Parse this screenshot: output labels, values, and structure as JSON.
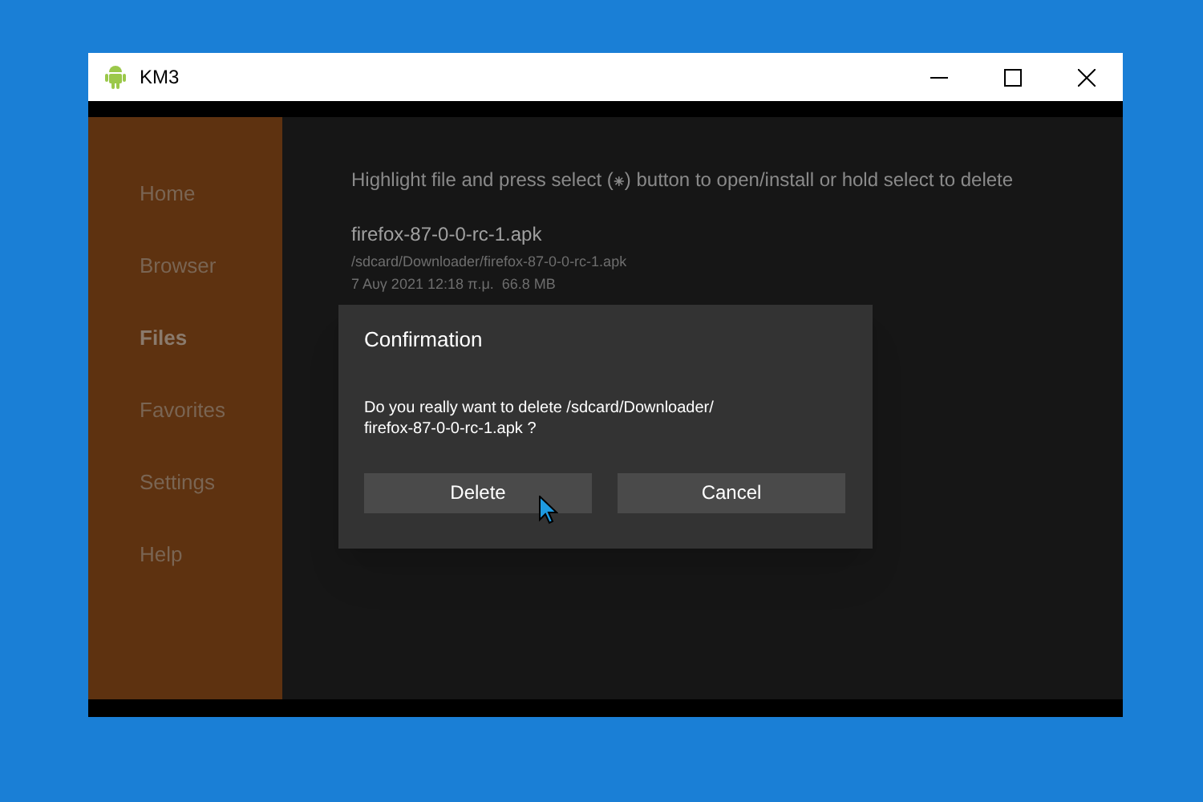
{
  "window": {
    "title": "KM3"
  },
  "sidebar": {
    "items": [
      {
        "label": "Home",
        "selected": false
      },
      {
        "label": "Browser",
        "selected": false
      },
      {
        "label": "Files",
        "selected": true
      },
      {
        "label": "Favorites",
        "selected": false
      },
      {
        "label": "Settings",
        "selected": false
      },
      {
        "label": "Help",
        "selected": false
      }
    ]
  },
  "content": {
    "hint": "Highlight file and press select (⁕) button to open/install or hold select to delete",
    "files": [
      {
        "name": "firefox-87-0-0-rc-1.apk",
        "path": "/sdcard/Downloader/firefox-87-0-0-rc-1.apk",
        "info": "7 Αυγ 2021 12:18 π.μ.  66.8 MB"
      }
    ]
  },
  "dialog": {
    "title": "Confirmation",
    "message": "Do you really want to delete /sdcard/Downloader/\nfirefox-87-0-0-rc-1.apk ?",
    "buttons": [
      "Delete",
      "Cancel"
    ]
  }
}
